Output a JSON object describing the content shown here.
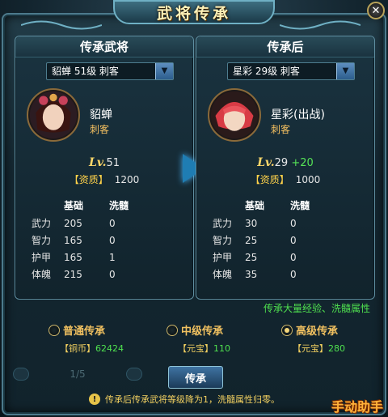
{
  "window": {
    "title": "武将传承",
    "close_label": "✕"
  },
  "left_panel": {
    "header": "传承武将",
    "select_value": "貂蝉 51级 刺客",
    "hero": {
      "name": "貂蝉",
      "class": "刺客"
    },
    "level": {
      "label": "Lv.",
      "value": "51",
      "bonus": ""
    },
    "aptitude": {
      "label": "【资质】",
      "value": "1200"
    },
    "stats": {
      "headers": [
        "",
        "基础",
        "洗髓"
      ],
      "rows": [
        {
          "name": "武力",
          "base": "205",
          "wash": "0"
        },
        {
          "name": "智力",
          "base": "165",
          "wash": "0"
        },
        {
          "name": "护甲",
          "base": "165",
          "wash": "1"
        },
        {
          "name": "体魄",
          "base": "215",
          "wash": "0"
        }
      ]
    }
  },
  "right_panel": {
    "header": "传承后",
    "select_value": "星彩 29级 刺客",
    "hero": {
      "name": "星彩(出战)",
      "class": "刺客"
    },
    "level": {
      "label": "Lv.",
      "value": "29",
      "bonus": "+20"
    },
    "aptitude": {
      "label": "【资质】",
      "value": "1000"
    },
    "stats": {
      "headers": [
        "",
        "基础",
        "洗髓"
      ],
      "rows": [
        {
          "name": "武力",
          "base": "30",
          "wash": "0"
        },
        {
          "name": "智力",
          "base": "25",
          "wash": "0"
        },
        {
          "name": "护甲",
          "base": "25",
          "wash": "0"
        },
        {
          "name": "体魄",
          "base": "35",
          "wash": "0"
        }
      ]
    },
    "hint": "传承大量经验、洗髓属性"
  },
  "modes": [
    {
      "label": "普通传承",
      "selected": false,
      "cost_label": "【铜币】",
      "cost_value": "62424"
    },
    {
      "label": "中级传承",
      "selected": false,
      "cost_label": "【元宝】",
      "cost_value": "110"
    },
    {
      "label": "高级传承",
      "selected": true,
      "cost_label": "【元宝】",
      "cost_value": "280"
    }
  ],
  "pager": {
    "text": "1/5"
  },
  "confirm_button": "传承",
  "warning": "传承后传承武将等级降为1，洗髓属性归零。",
  "watermark": "手动助手",
  "colors": {
    "accent": "#f0c060",
    "positive": "#4fe04f",
    "frame": "#4c7a8c"
  }
}
